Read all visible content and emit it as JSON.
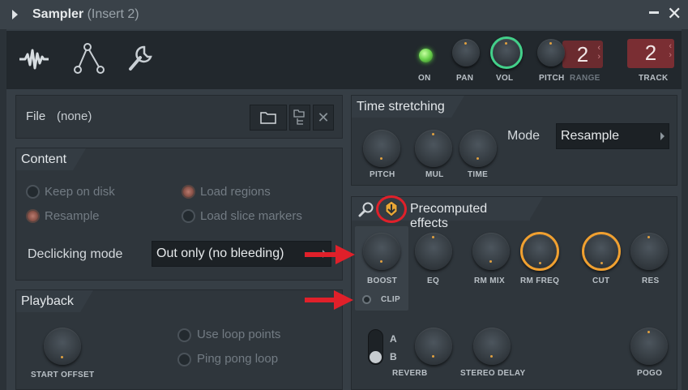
{
  "window": {
    "title": "Sampler",
    "subtitle": "(Insert 2)"
  },
  "toolbar": {
    "icons": [
      "waveform-icon",
      "envelope-icon",
      "wrench-icon"
    ],
    "on_label": "ON",
    "pan_label": "PAN",
    "vol_label": "VOL",
    "pitch_label": "PITCH",
    "range_label": "RANGE",
    "range_value": "2",
    "track_label": "TRACK",
    "track_value": "2"
  },
  "file": {
    "label": "File",
    "value": "(none)"
  },
  "content": {
    "title": "Content",
    "options": {
      "keep_on_disk": "Keep on disk",
      "resample": "Resample",
      "load_regions": "Load regions",
      "load_slice_markers": "Load slice markers"
    },
    "declicking_label": "Declicking mode",
    "declicking_value": "Out only (no bleeding)"
  },
  "playback": {
    "title": "Playback",
    "start_offset_label": "START OFFSET",
    "use_loop_points": "Use loop points",
    "ping_pong_loop": "Ping pong loop"
  },
  "time_stretching": {
    "title": "Time stretching",
    "pitch_label": "PITCH",
    "mul_label": "MUL",
    "time_label": "TIME",
    "mode_label": "Mode",
    "mode_value": "Resample"
  },
  "precomputed": {
    "title": "Precomputed effects",
    "boost_label": "BOOST",
    "eq_label": "EQ",
    "rm_mix_label": "RM MIX",
    "rm_freq_label": "RM FREQ",
    "cut_label": "CUT",
    "res_label": "RES",
    "clip_label": "CLIP",
    "toggle_a": "A",
    "toggle_b": "B",
    "reverb_label": "REVERB",
    "stereo_delay_label": "STEREO DELAY",
    "pogo_label": "POGO"
  },
  "colors": {
    "accent_green": "#43d08a",
    "accent_orange": "#f0a030",
    "annotation_red": "#e0202a"
  }
}
